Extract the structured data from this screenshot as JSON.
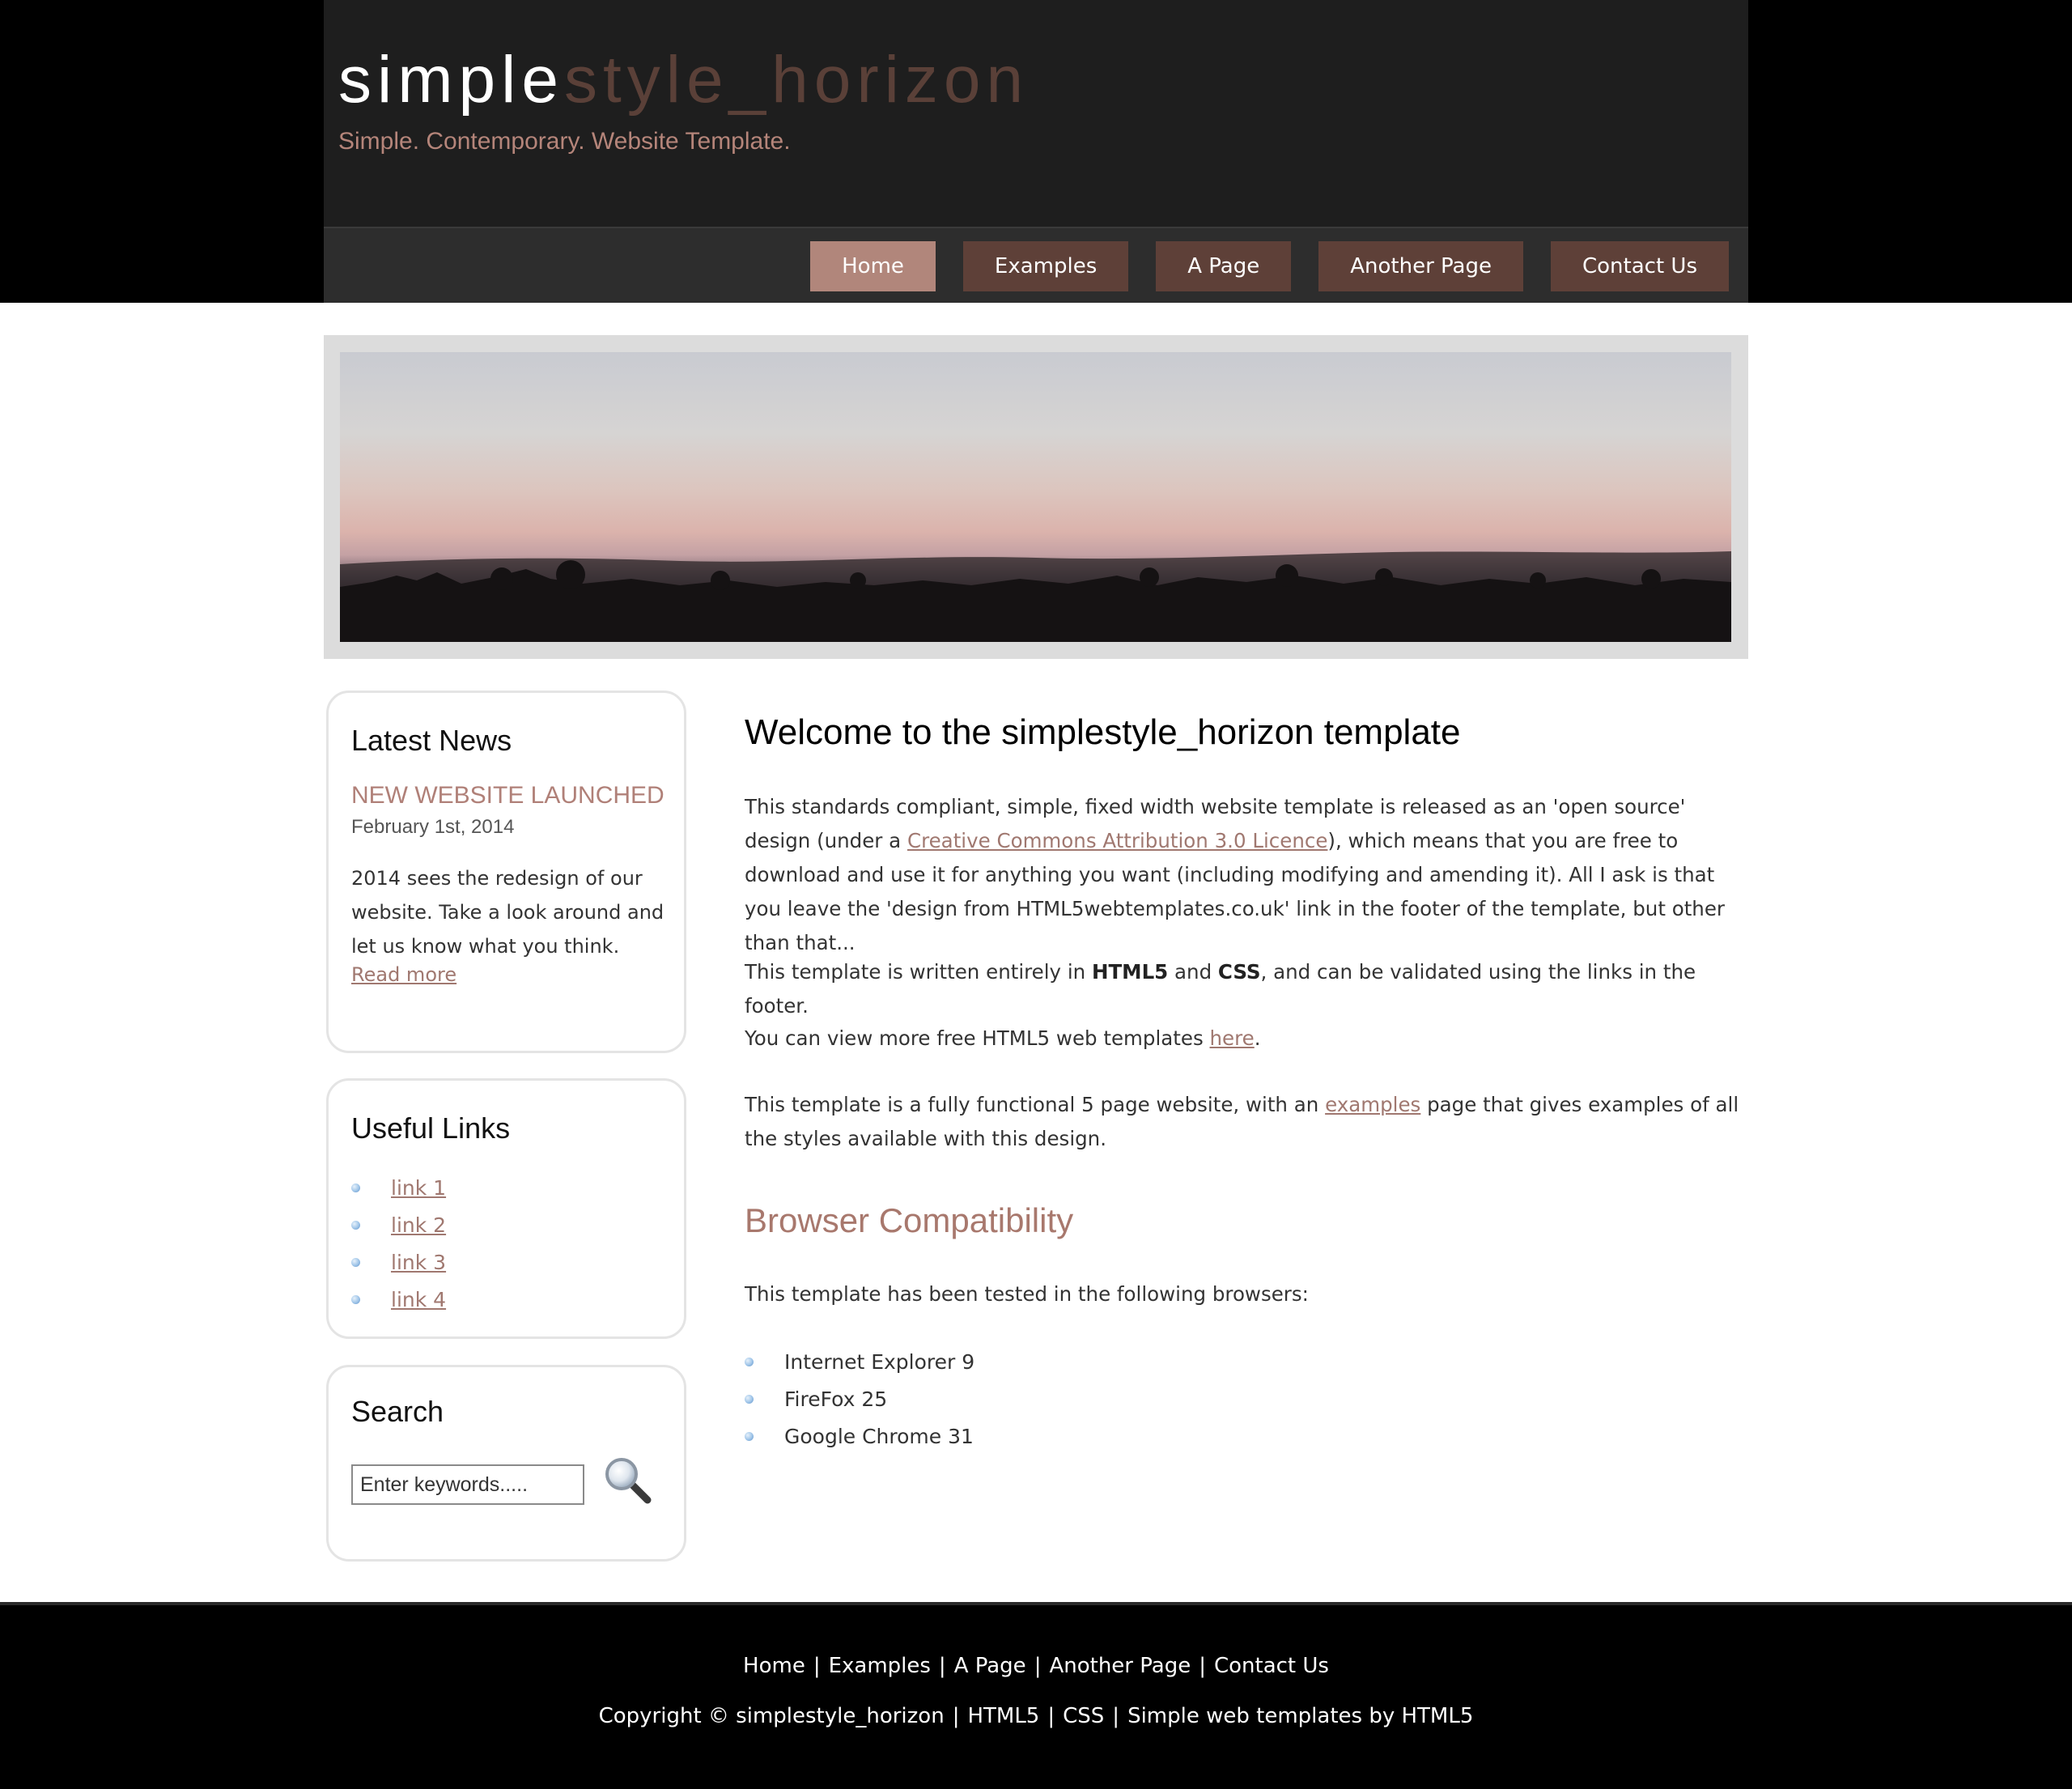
{
  "header": {
    "logo_part1": "simple",
    "logo_part2": "style_horizon",
    "slogan": "Simple. Contemporary. Website Template."
  },
  "menu": [
    {
      "label": "Home",
      "selected": true
    },
    {
      "label": "Examples",
      "selected": false
    },
    {
      "label": "A Page",
      "selected": false
    },
    {
      "label": "Another Page",
      "selected": false
    },
    {
      "label": "Contact Us",
      "selected": false
    }
  ],
  "sidebar": {
    "news": {
      "heading": "Latest News",
      "title": "NEW WEBSITE LAUNCHED",
      "date": "February 1st, 2014",
      "text": "2014 sees the redesign of our website. Take a look around and let us know what you think.",
      "read_more": "Read more"
    },
    "links": {
      "heading": "Useful Links",
      "items": [
        "link 1",
        "link 2",
        "link 3",
        "link 4"
      ]
    },
    "search": {
      "heading": "Search",
      "placeholder": "Enter keywords.....",
      "button_icon": "magnifier-icon"
    }
  },
  "content": {
    "title": "Welcome to the simplestyle_horizon template",
    "p1_a": "This standards compliant, simple, fixed width website template is released as an 'open source' design (under a ",
    "p1_link": "Creative Commons Attribution 3.0 Licence",
    "p1_b": "), which means that you are free to download and use it for anything you want (including modifying and amending it). All I ask is that you leave the 'design from HTML5webtemplates.co.uk' link in the footer of the template, but other than that...",
    "p2_a": "This template is written entirely in ",
    "p2_b1": "HTML5",
    "p2_mid": " and ",
    "p2_b2": "CSS",
    "p2_c": ", and can be validated using the links in the footer.",
    "p3_a": "You can view more free HTML5 web templates ",
    "p3_link": "here",
    "p3_b": ".",
    "p4_a": "This template is a fully functional 5 page website, with an ",
    "p4_link": "examples",
    "p4_b": " page that gives examples of all the styles available with this design.",
    "compat_title": "Browser Compatibility",
    "compat_text": "This template has been tested in the following browsers:",
    "browsers": [
      "Internet Explorer 9",
      "FireFox 25",
      "Google Chrome 31"
    ]
  },
  "footer": {
    "nav": [
      "Home",
      "Examples",
      "A Page",
      "Another Page",
      "Contact Us"
    ],
    "separator": "|",
    "copyright": "Copyright © simplestyle_horizon",
    "links": [
      "HTML5",
      "CSS",
      "Simple web templates by HTML5"
    ]
  },
  "colors": {
    "accent": "#b1867b",
    "menu_item": "#5e4038",
    "link": "#a07870",
    "header_bg": "#1e1e1e"
  }
}
